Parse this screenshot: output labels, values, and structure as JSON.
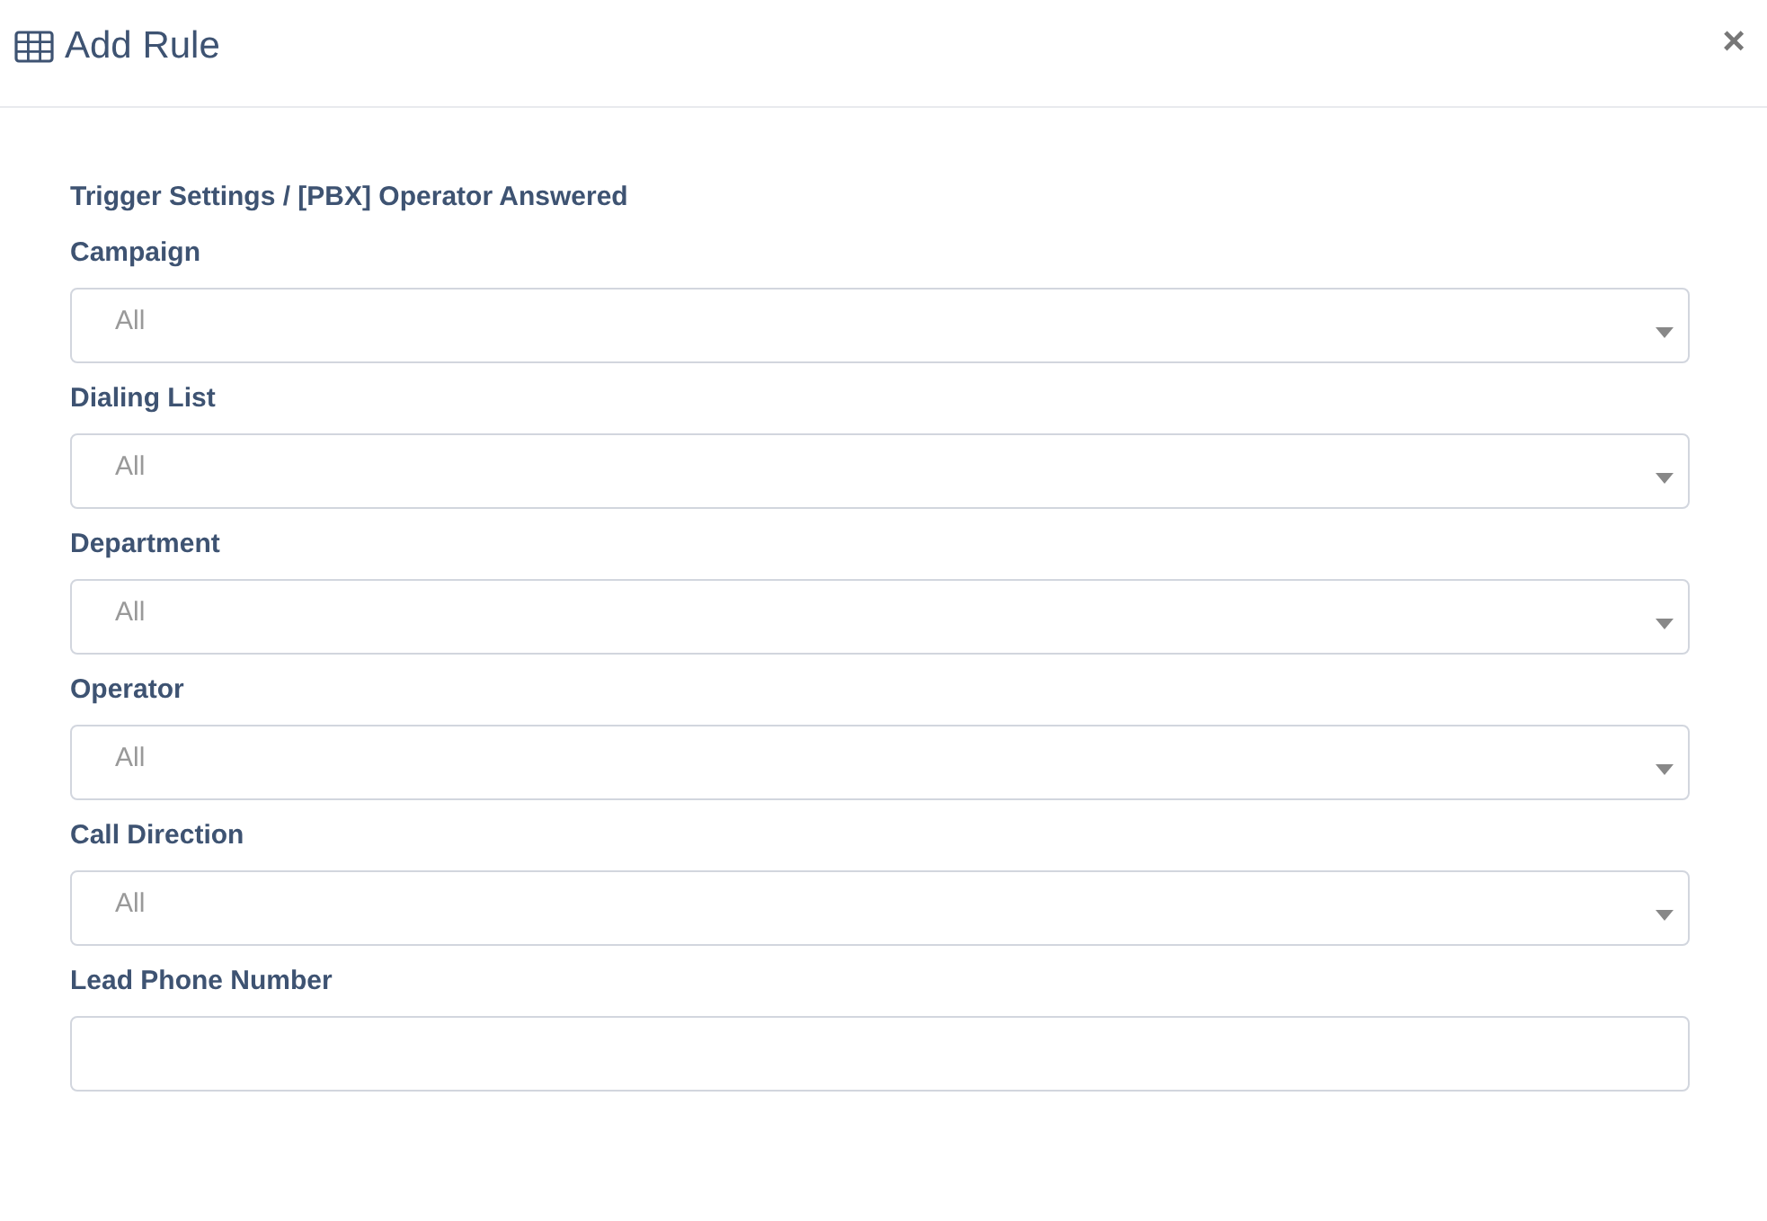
{
  "dialog": {
    "title": "Add Rule",
    "close": "×"
  },
  "section_title": "Trigger Settings / [PBX] Operator Answered",
  "fields": [
    {
      "label": "Campaign",
      "kind": "select",
      "value": "All"
    },
    {
      "label": "Dialing List",
      "kind": "select",
      "value": "All"
    },
    {
      "label": "Department",
      "kind": "select",
      "value": "All"
    },
    {
      "label": "Operator",
      "kind": "select",
      "value": "All"
    },
    {
      "label": "Call Direction",
      "kind": "select",
      "value": "All"
    },
    {
      "label": "Lead Phone Number",
      "kind": "text"
    }
  ]
}
